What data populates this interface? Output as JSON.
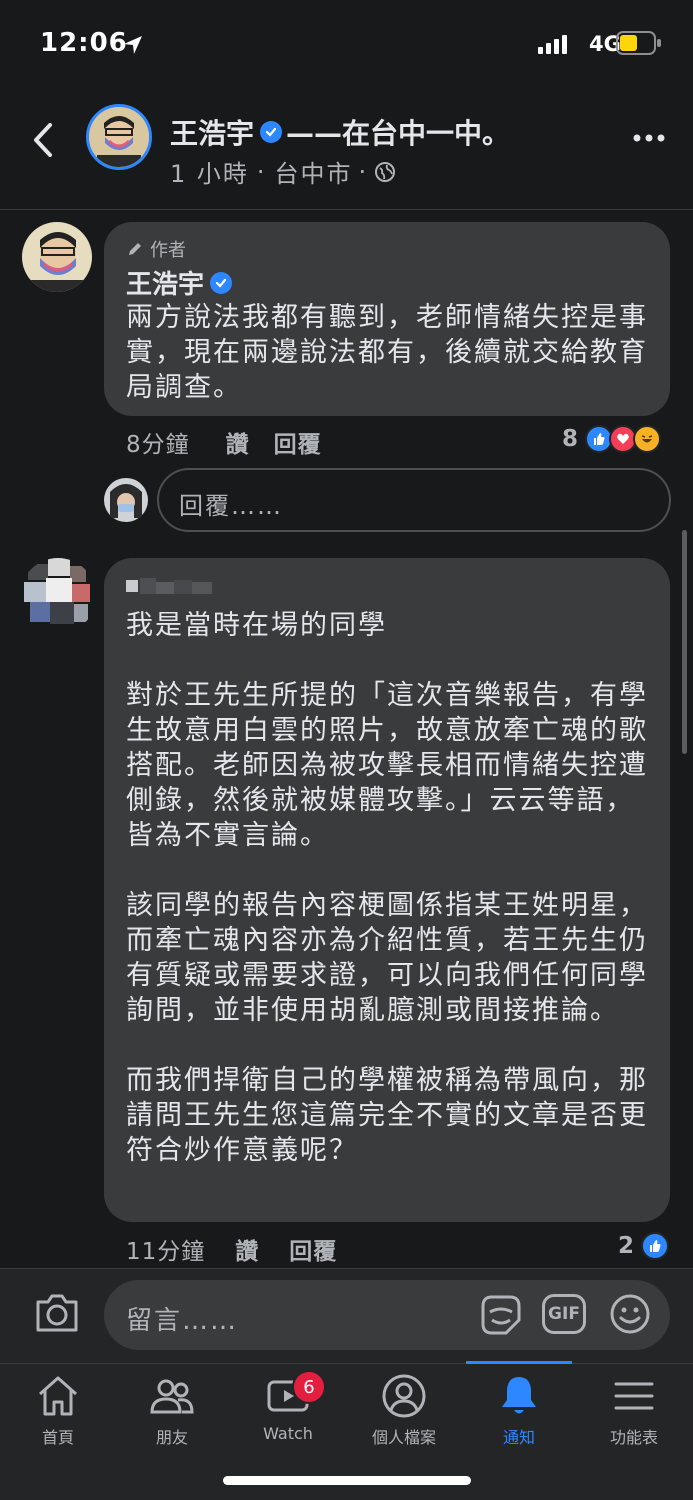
{
  "status_bar": {
    "time": "12:06",
    "network": "4G"
  },
  "header": {
    "author": "王浩宇",
    "location_suffix": "——在台中一中。",
    "time_ago": "1 小時",
    "city": "台中市"
  },
  "comments": [
    {
      "badge": "作者",
      "name": "王浩宇",
      "text": "兩方說法我都有聽到，老師情緒失控是事實，現在兩邊說法都有，後續就交給教育局調查。",
      "time": "8分鐘",
      "like_label": "讚",
      "reply_label": "回覆",
      "reaction_count": "8"
    },
    {
      "name": "",
      "text": "我是當時在場的同學\n\n對於王先生所提的「這次音樂報告，有學生故意用白雲的照片，故意放牽亡魂的歌搭配。老師因為被攻擊長相而情緒失控遭側錄，然後就被媒體攻擊。」云云等語，皆為不實言論。\n\n該同學的報告內容梗圖係指某王姓明星，而牽亡魂內容亦為介紹性質，若王先生仍有質疑或需要求證，可以向我們任何同學詢問，並非使用胡亂臆測或間接推論。\n\n而我們捍衛自己的學權被稱為帶風向，那請問王先生您這篇完全不實的文章是否更符合炒作意義呢？",
      "time": "11分鐘",
      "like_label": "讚",
      "reply_label": "回覆",
      "reaction_count": "2"
    }
  ],
  "reply_input": {
    "placeholder": "回覆……"
  },
  "composer": {
    "placeholder": "留言……",
    "gif_label": "GIF"
  },
  "tabs": [
    {
      "label": "首頁",
      "icon": "home-icon"
    },
    {
      "label": "朋友",
      "icon": "friends-icon"
    },
    {
      "label": "Watch",
      "icon": "watch-icon",
      "badge": "6"
    },
    {
      "label": "個人檔案",
      "icon": "profile-icon"
    },
    {
      "label": "通知",
      "icon": "bell-icon",
      "active": true
    },
    {
      "label": "功能表",
      "icon": "menu-icon"
    }
  ],
  "colors": {
    "accent": "#2d88ff",
    "background": "#18191a",
    "bubble": "#3a3b3c",
    "badge": "#e41e3f"
  }
}
